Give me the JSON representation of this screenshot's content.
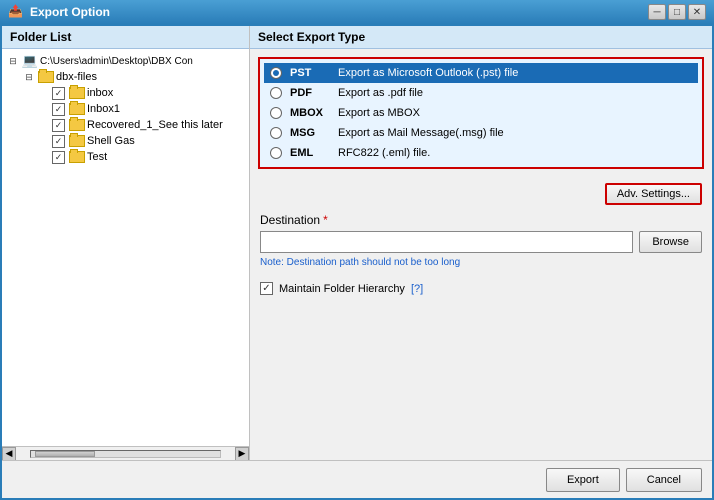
{
  "titleBar": {
    "title": "Export Option",
    "iconSymbol": "📤"
  },
  "leftPanel": {
    "header": "Folder List",
    "tree": {
      "rootPath": "C:\\Users\\admin\\Desktop\\DBX Con",
      "dbxFolder": "dbx-files",
      "items": [
        {
          "label": "inbox",
          "checked": true
        },
        {
          "label": "Inbox1",
          "checked": true
        },
        {
          "label": "Recovered_1_See this later",
          "checked": true
        },
        {
          "label": "Shell Gas",
          "checked": true
        },
        {
          "label": "Test",
          "checked": true
        }
      ]
    }
  },
  "rightPanel": {
    "header": "Select Export Type",
    "exportOptions": [
      {
        "code": "PST",
        "desc": "Export as Microsoft Outlook (.pst) file",
        "selected": true
      },
      {
        "code": "PDF",
        "desc": "Export as .pdf file",
        "selected": false
      },
      {
        "code": "MBOX",
        "desc": "Export as MBOX",
        "selected": false
      },
      {
        "code": "MSG",
        "desc": "Export as Mail Message(.msg) file",
        "selected": false
      },
      {
        "code": "EML",
        "desc": "RFC822 (.eml) file.",
        "selected": false
      }
    ],
    "advSettingsLabel": "Adv. Settings...",
    "destination": {
      "label": "Destination",
      "required": true,
      "placeholder": "",
      "note": "Note: Destination path should not be too long",
      "browseLabel": "Browse"
    },
    "maintainHierarchy": {
      "label": "Maintain Folder Hierarchy",
      "checked": true,
      "helpLabel": "[?]"
    }
  },
  "bottomBar": {
    "exportLabel": "Export",
    "cancelLabel": "Cancel"
  }
}
